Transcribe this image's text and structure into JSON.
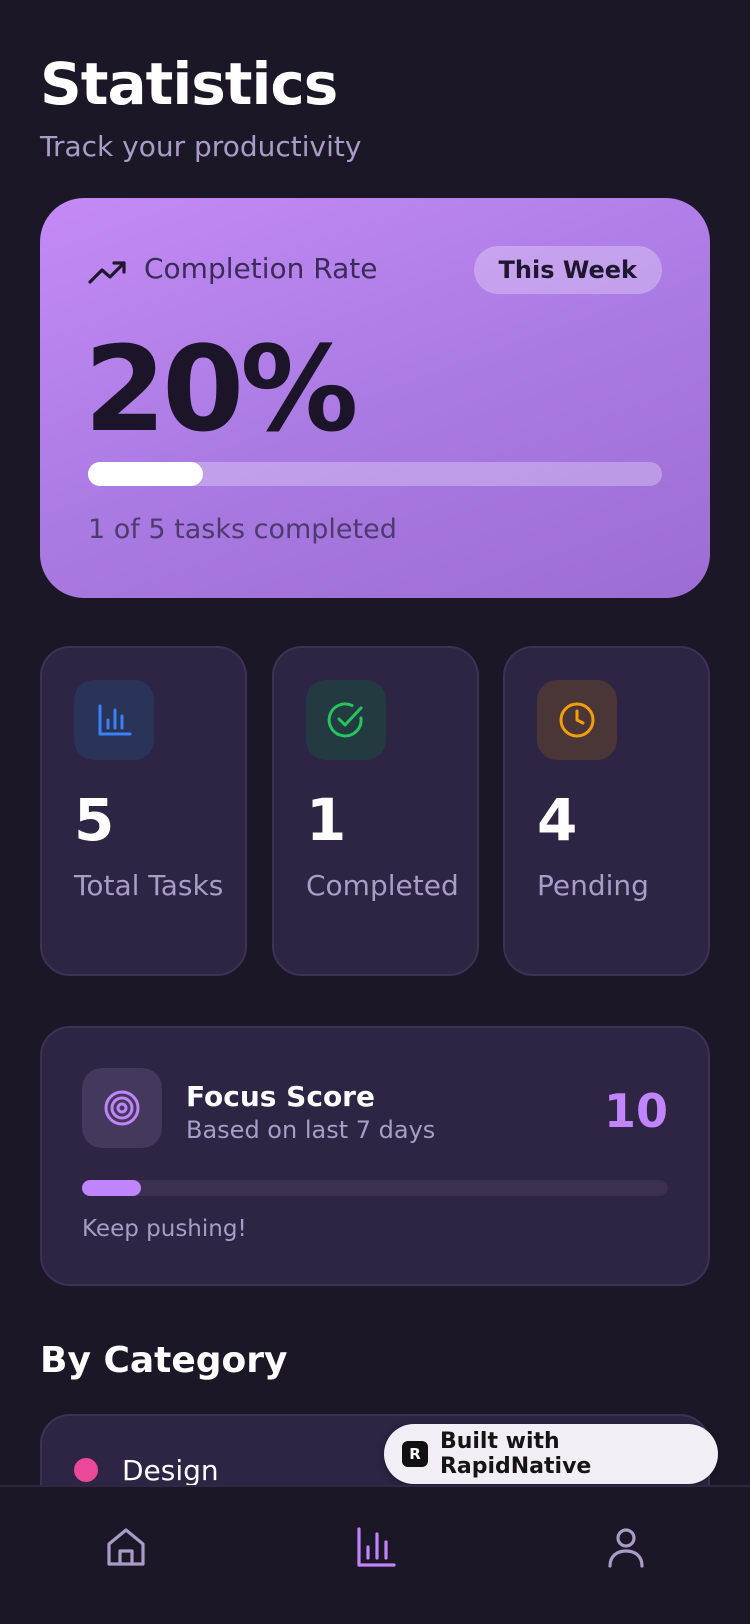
{
  "header": {
    "title": "Statistics",
    "subtitle": "Track your productivity"
  },
  "completion": {
    "label": "Completion Rate",
    "period_badge": "This Week",
    "value": "20%",
    "progress_fraction": 0.2,
    "caption": "1 of 5 tasks completed",
    "icon": "trending-up-icon"
  },
  "stats": [
    {
      "value": "5",
      "label": "Total Tasks",
      "icon": "bar-chart-icon",
      "color": "#3b82f6",
      "bg": "#2a3358"
    },
    {
      "value": "1",
      "label": "Completed",
      "icon": "check-circle-icon",
      "color": "#22c55e",
      "bg": "#233a40"
    },
    {
      "value": "4",
      "label": "Pending",
      "icon": "clock-icon",
      "color": "#f59e0b",
      "bg": "#4a3637"
    }
  ],
  "focus": {
    "title": "Focus Score",
    "subtitle": "Based on last 7 days",
    "value": "10",
    "progress_fraction": 0.1,
    "caption": "Keep pushing!",
    "icon": "target-icon",
    "accent": "#c084fc"
  },
  "category": {
    "section_title": "By Category",
    "items": [
      {
        "name": "Design",
        "color": "#ec4899"
      }
    ]
  },
  "badge": {
    "text": "Built with RapidNative"
  },
  "nav": {
    "items": [
      {
        "name": "home",
        "icon": "home-icon",
        "active": false
      },
      {
        "name": "stats",
        "icon": "bar-chart-icon",
        "active": true
      },
      {
        "name": "profile",
        "icon": "user-icon",
        "active": false
      }
    ],
    "active_color": "#c084fc",
    "inactive_color": "#a99cc6"
  }
}
